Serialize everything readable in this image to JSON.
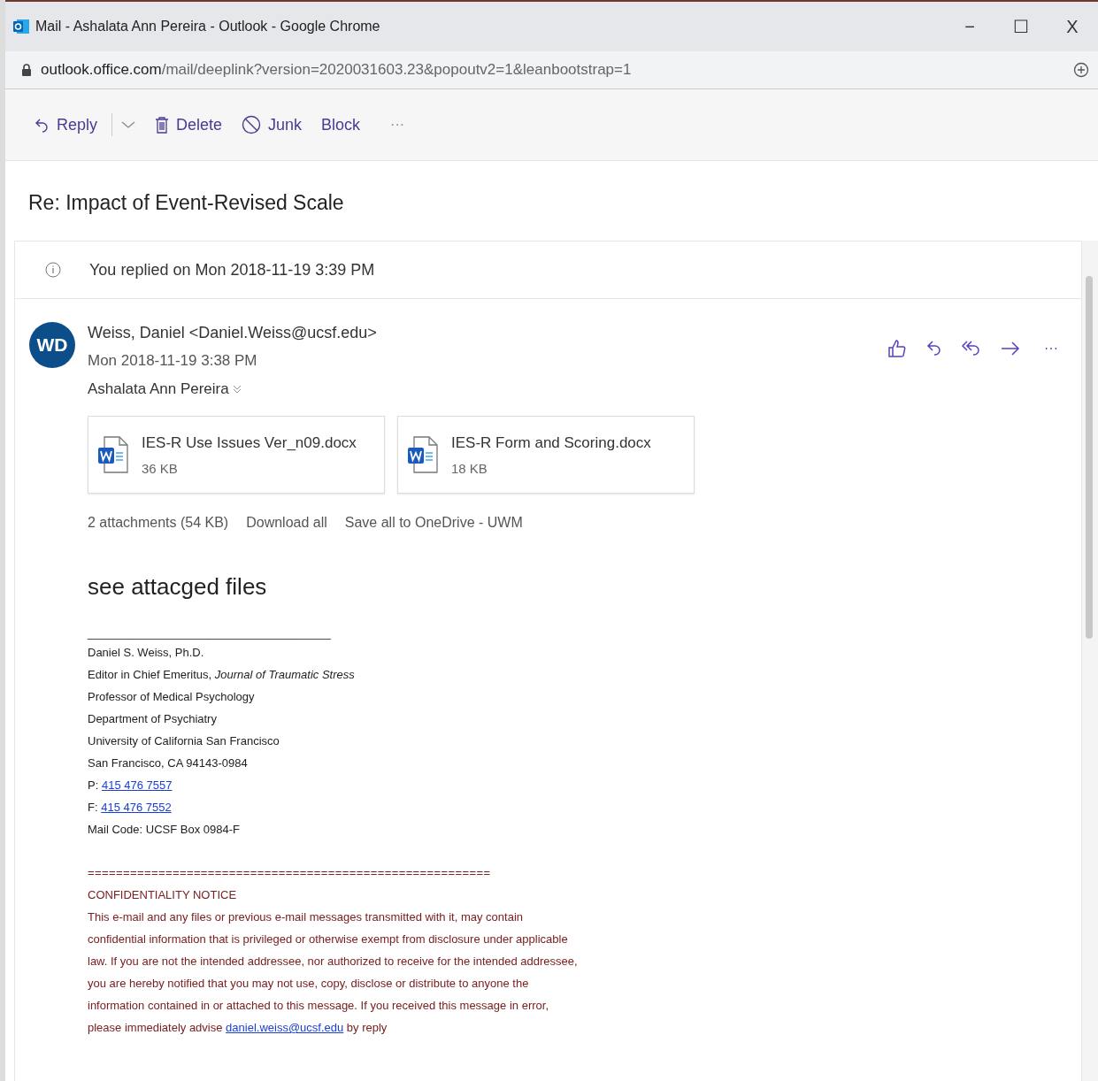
{
  "window": {
    "title": "Mail - Ashalata Ann Pereira - Outlook - Google Chrome",
    "controls": [
      "−",
      "☐",
      "X"
    ]
  },
  "address_bar": {
    "host": "outlook.office.com",
    "path": "/mail/deeplink?version=2020031603.23&popoutv2=1&leanbootstrap=1"
  },
  "toolbar": [
    {
      "kind": "reply",
      "label": "Reply"
    },
    {
      "kind": "caret"
    },
    {
      "kind": "delete",
      "label": "Delete"
    },
    {
      "kind": "junk",
      "label": "Junk"
    },
    {
      "kind": "text",
      "label": "Block"
    },
    {
      "kind": "more",
      "label": "···"
    }
  ],
  "subject": "Re: Impact of Event-Revised Scale",
  "info_bar": "You replied on Mon 2018-11-19 3:39 PM",
  "message": {
    "initials": "WD",
    "sender": "Weiss, Daniel <Daniel.Weiss@ucsf.edu>",
    "date": "Mon 2018-11-19 3:38 PM",
    "recipient": "Ashalata Ann Pereira",
    "actions": [
      {
        "kind": "like"
      },
      {
        "kind": "reply"
      },
      {
        "kind": "reply_all"
      },
      {
        "kind": "forward"
      },
      {
        "kind": "more",
        "label": "···"
      }
    ],
    "attachments": [
      {
        "name": "IES-R Use Issues Ver_n09.docx",
        "size": "36 KB"
      },
      {
        "name": "IES-R Form and Scoring.docx",
        "size": "18 KB"
      }
    ],
    "attachment_summary": "2 attachments (54 KB)",
    "attachment_links": [
      "Download all",
      "Save all to OneDrive - UWM"
    ],
    "body": "see attacged files",
    "signature_rule": "______________________________________",
    "signature": [
      {
        "text": "Daniel S. Weiss, Ph.D."
      },
      {
        "text": "Editor in Chief Emeritus, *Journal of Traumatic Stress*"
      },
      {
        "text": "Professor of Medical Psychology"
      },
      {
        "text": "Department of Psychiatry"
      },
      {
        "text": "University of California San Francisco"
      },
      {
        "text": "San Francisco, CA 94143-0984"
      },
      {
        "text": "P:",
        "link": "415 476 7557"
      },
      {
        "text": "F:",
        "link": "415 476 7552"
      },
      {
        "text": "Mail Code: UCSF Box 0984-F"
      }
    ],
    "notice": {
      "rule": "=========================================================",
      "title": "CONFIDENTIALITY NOTICE",
      "text_before": "This e-mail and any files or previous e-mail messages transmitted with it, may contain confidential information that is privileged or otherwise exempt from disclosure under applicable law. If you are not the intended addressee, nor authorized to receive for the intended addressee, you are hereby notified that you may not use, copy, disclose or distribute to anyone the information contained in or attached to this message. If you received this message in error, please immediately advise",
      "link": "daniel.weiss@ucsf.edu",
      "text_after": "by reply"
    }
  }
}
